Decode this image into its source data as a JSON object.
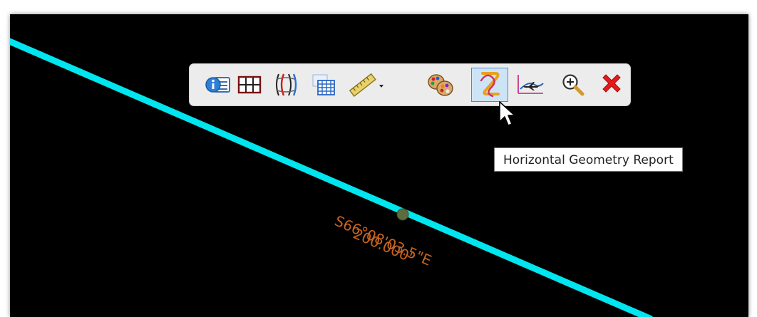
{
  "colors": {
    "background": "#000000",
    "alignment_line": "#00e5ee",
    "label_text": "#c8641e",
    "pi_point": "#5e6b3c"
  },
  "toolbar": {
    "buttons": [
      {
        "icon": "element-info-icon",
        "title": "Element Information"
      },
      {
        "icon": "table-grid-icon",
        "title": "Table"
      },
      {
        "icon": "profile-curves-icon",
        "title": "Profile"
      },
      {
        "icon": "spreadsheet-icon",
        "title": "Spreadsheet"
      },
      {
        "icon": "measure-ruler-icon",
        "title": "Measure"
      },
      {
        "icon": "palette-icon",
        "title": "Feature Definition"
      },
      {
        "icon": "horizontal-geometry-icon",
        "title": "Horizontal Geometry Report",
        "active": true
      },
      {
        "icon": "vertical-profile-icon",
        "title": "Vertical Profile"
      },
      {
        "icon": "zoom-in-icon",
        "title": "Zoom"
      },
      {
        "icon": "close-x-icon",
        "title": "Close"
      }
    ]
  },
  "tooltip": {
    "text": "Horizontal Geometry Report"
  },
  "annotation": {
    "bearing": "S66°08'03.5\"E",
    "distance": "200.000'"
  }
}
